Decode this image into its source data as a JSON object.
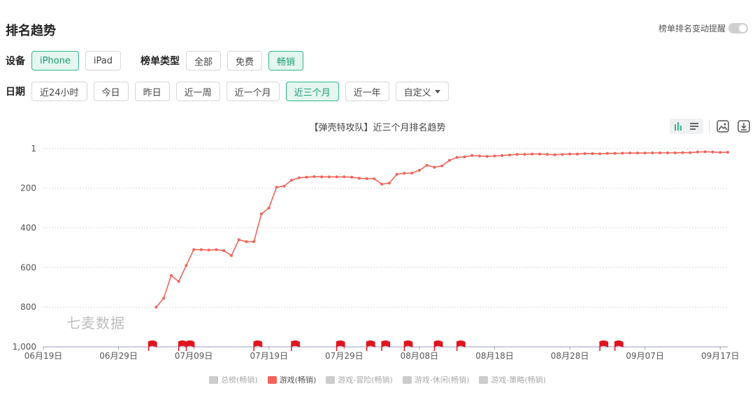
{
  "header": {
    "title": "排名趋势",
    "toggle_label": "榜单排名变动提醒"
  },
  "filters": {
    "device_label": "设备",
    "devices": [
      {
        "label": "iPhone",
        "active": true
      },
      {
        "label": "iPad",
        "active": false
      }
    ],
    "type_label": "榜单类型",
    "types": [
      {
        "label": "全部",
        "active": false
      },
      {
        "label": "免费",
        "active": false
      },
      {
        "label": "畅销",
        "active": true
      }
    ],
    "date_label": "日期",
    "dates": [
      {
        "label": "近24小时",
        "active": false
      },
      {
        "label": "今日",
        "active": false
      },
      {
        "label": "昨日",
        "active": false
      },
      {
        "label": "近一周",
        "active": false
      },
      {
        "label": "近一个月",
        "active": false
      },
      {
        "label": "近三个月",
        "active": true
      },
      {
        "label": "近一年",
        "active": false
      }
    ],
    "custom_label": "自定义"
  },
  "watermark": "七麦数据",
  "colors": {
    "series": "#f0645a",
    "accent": "#33b68a",
    "flag": "#e0141e",
    "grid": "#d9d9d9",
    "axis": "#9a9ec0"
  },
  "chart_data": {
    "type": "line",
    "title": "【弹壳特攻队】近三个月排名趋势",
    "y_reversed": true,
    "ylim": [
      1,
      1000
    ],
    "y_ticks": [
      1,
      200,
      400,
      600,
      800,
      1000
    ],
    "y_tick_labels": [
      "1",
      "200",
      "400",
      "600",
      "800",
      "1,000"
    ],
    "x_range": [
      "2022-06-19",
      "2022-09-18"
    ],
    "x_ticks": [
      "06月19日",
      "06月29日",
      "07月09日",
      "07月19日",
      "07月29日",
      "08月08日",
      "08月18日",
      "08月28日",
      "09月07日",
      "09月17日"
    ],
    "series": [
      {
        "name": "游戏(畅销)",
        "x": [
          "2022-07-04",
          "2022-07-05",
          "2022-07-06",
          "2022-07-07",
          "2022-07-08",
          "2022-07-09",
          "2022-07-10",
          "2022-07-11",
          "2022-07-12",
          "2022-07-13",
          "2022-07-14",
          "2022-07-15",
          "2022-07-16",
          "2022-07-17",
          "2022-07-18",
          "2022-07-19",
          "2022-07-20",
          "2022-07-21",
          "2022-07-22",
          "2022-07-23",
          "2022-07-24",
          "2022-07-25",
          "2022-07-26",
          "2022-07-27",
          "2022-07-28",
          "2022-07-29",
          "2022-07-30",
          "2022-07-31",
          "2022-08-01",
          "2022-08-02",
          "2022-08-03",
          "2022-08-04",
          "2022-08-05",
          "2022-08-06",
          "2022-08-07",
          "2022-08-08",
          "2022-08-09",
          "2022-08-10",
          "2022-08-11",
          "2022-08-12",
          "2022-08-13",
          "2022-08-14",
          "2022-08-15",
          "2022-08-16",
          "2022-08-17",
          "2022-08-18",
          "2022-08-19",
          "2022-08-20",
          "2022-08-21",
          "2022-08-22",
          "2022-08-23",
          "2022-08-24",
          "2022-08-25",
          "2022-08-26",
          "2022-08-27",
          "2022-08-28",
          "2022-08-29",
          "2022-08-30",
          "2022-08-31",
          "2022-09-01",
          "2022-09-02",
          "2022-09-03",
          "2022-09-04",
          "2022-09-05",
          "2022-09-06",
          "2022-09-07",
          "2022-09-08",
          "2022-09-09",
          "2022-09-10",
          "2022-09-11",
          "2022-09-12",
          "2022-09-13",
          "2022-09-14",
          "2022-09-15",
          "2022-09-16",
          "2022-09-17",
          "2022-09-18"
        ],
        "values": [
          800,
          755,
          640,
          670,
          590,
          510,
          510,
          512,
          510,
          515,
          540,
          460,
          470,
          470,
          330,
          300,
          195,
          190,
          160,
          148,
          145,
          142,
          143,
          143,
          143,
          143,
          145,
          150,
          152,
          153,
          180,
          175,
          130,
          125,
          124,
          110,
          85,
          95,
          88,
          60,
          45,
          43,
          36,
          38,
          40,
          38,
          36,
          33,
          30,
          30,
          28,
          28,
          30,
          32,
          30,
          28,
          28,
          26,
          26,
          27,
          25,
          25,
          24,
          23,
          23,
          23,
          22,
          22,
          22,
          22,
          21,
          21,
          18,
          17,
          18,
          20,
          19
        ]
      }
    ],
    "annotations": {
      "type": "flag",
      "dates": [
        "2022-07-03",
        "2022-07-07",
        "2022-07-08",
        "2022-07-17",
        "2022-07-22",
        "2022-07-28",
        "2022-08-01",
        "2022-08-03",
        "2022-08-06",
        "2022-08-10",
        "2022-08-13",
        "2022-09-01",
        "2022-09-03"
      ]
    },
    "legend": [
      {
        "name": "总榜(畅销)",
        "active": false
      },
      {
        "name": "游戏(畅销)",
        "active": true
      },
      {
        "name": "游戏-冒险(畅销)",
        "active": false
      },
      {
        "name": "游戏-休闲(畅销)",
        "active": false
      },
      {
        "name": "游戏-策略(畅销)",
        "active": false
      }
    ],
    "legend_position": "bottom"
  }
}
